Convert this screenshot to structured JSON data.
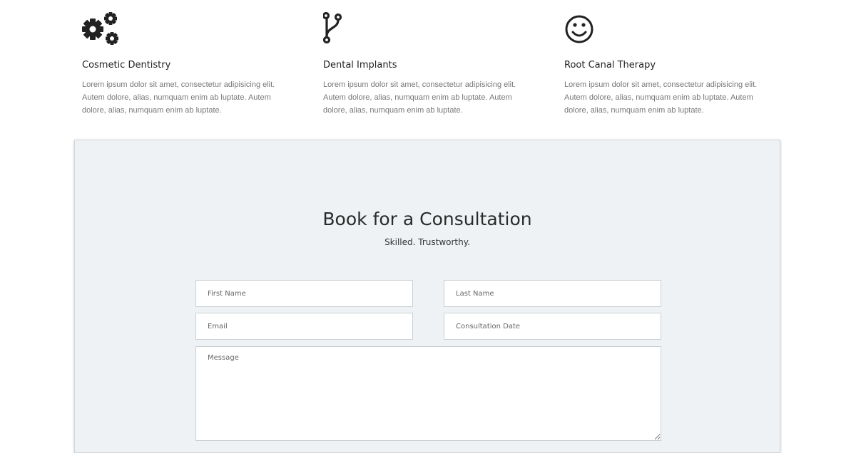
{
  "features": [
    {
      "icon": "gears-icon",
      "title": "Cosmetic Dentistry",
      "description": "Lorem ipsum dolor sit amet, consectetur adipisicing elit. Autem dolore, alias, numquam enim ab luptate. Autem dolore, alias, numquam enim ab luptate."
    },
    {
      "icon": "branch-icon",
      "title": "Dental Implants",
      "description": "Lorem ipsum dolor sit amet, consectetur adipisicing elit. Autem dolore, alias, numquam enim ab luptate. Autem dolore, alias, numquam enim ab luptate."
    },
    {
      "icon": "smiley-icon",
      "title": "Root Canal Therapy",
      "description": "Lorem ipsum dolor sit amet, consectetur adipisicing elit. Autem dolore, alias, numquam enim ab luptate. Autem dolore, alias, numquam enim ab luptate."
    }
  ],
  "booking": {
    "title": "Book for a Consultation",
    "subtitle": "Skilled. Trustworthy.",
    "form": {
      "first_name_placeholder": "First Name",
      "last_name_placeholder": "Last Name",
      "email_placeholder": "Email",
      "date_placeholder": "Consultation Date",
      "message_placeholder": "Message"
    }
  },
  "colors": {
    "section_background": "#eef2f5",
    "body_text": "#777777",
    "heading_text": "#222222"
  }
}
